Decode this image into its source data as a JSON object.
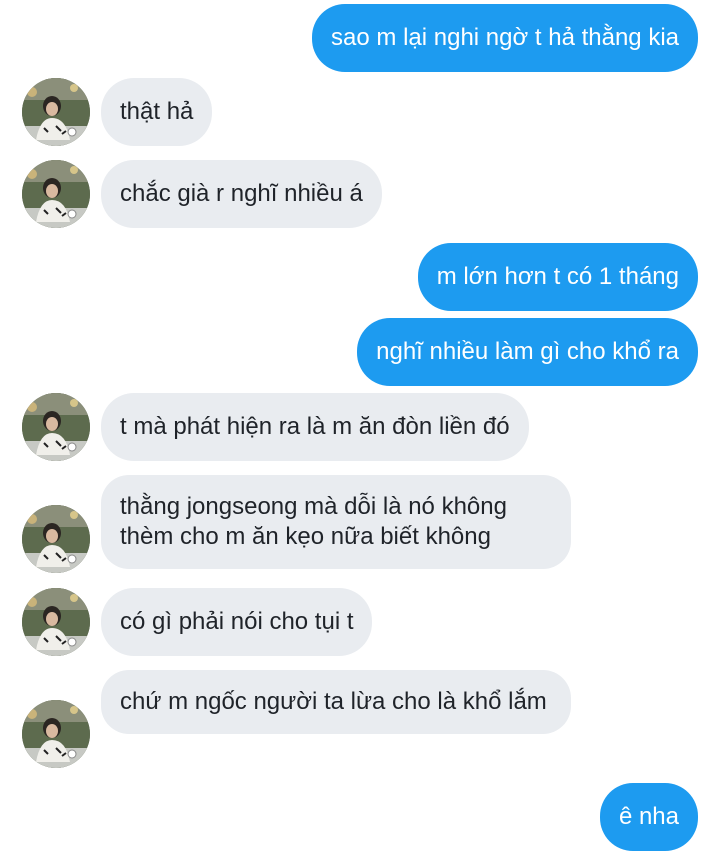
{
  "messages": [
    {
      "side": "out",
      "text": "sao m lại nghi ngờ t hả thằng kia"
    },
    {
      "side": "in",
      "text": "thật hả"
    },
    {
      "side": "in",
      "text": "chắc già r nghĩ nhiều á"
    },
    {
      "side": "out",
      "text": "m lớn hơn t có 1 tháng"
    },
    {
      "side": "out",
      "text": "nghĩ nhiều làm gì cho khổ ra"
    },
    {
      "side": "in",
      "text": "t mà phát hiện ra là m ăn đòn liền đó"
    },
    {
      "side": "in",
      "text": "thằng jongseong mà dỗi là nó không thèm cho m ăn kẹo nữa biết không"
    },
    {
      "side": "in",
      "text": "có gì phải nói cho tụi t"
    },
    {
      "side": "in",
      "text": "chứ m ngốc người ta lừa cho là khổ lắm"
    },
    {
      "side": "out",
      "text": "ê nha"
    }
  ],
  "colors": {
    "outgoing_bubble": "#1d9bf0",
    "incoming_bubble": "#e9ecf0",
    "outgoing_text": "#ffffff",
    "incoming_text": "#1f2329"
  },
  "contact_avatar_icon": "profile-photo-icon"
}
